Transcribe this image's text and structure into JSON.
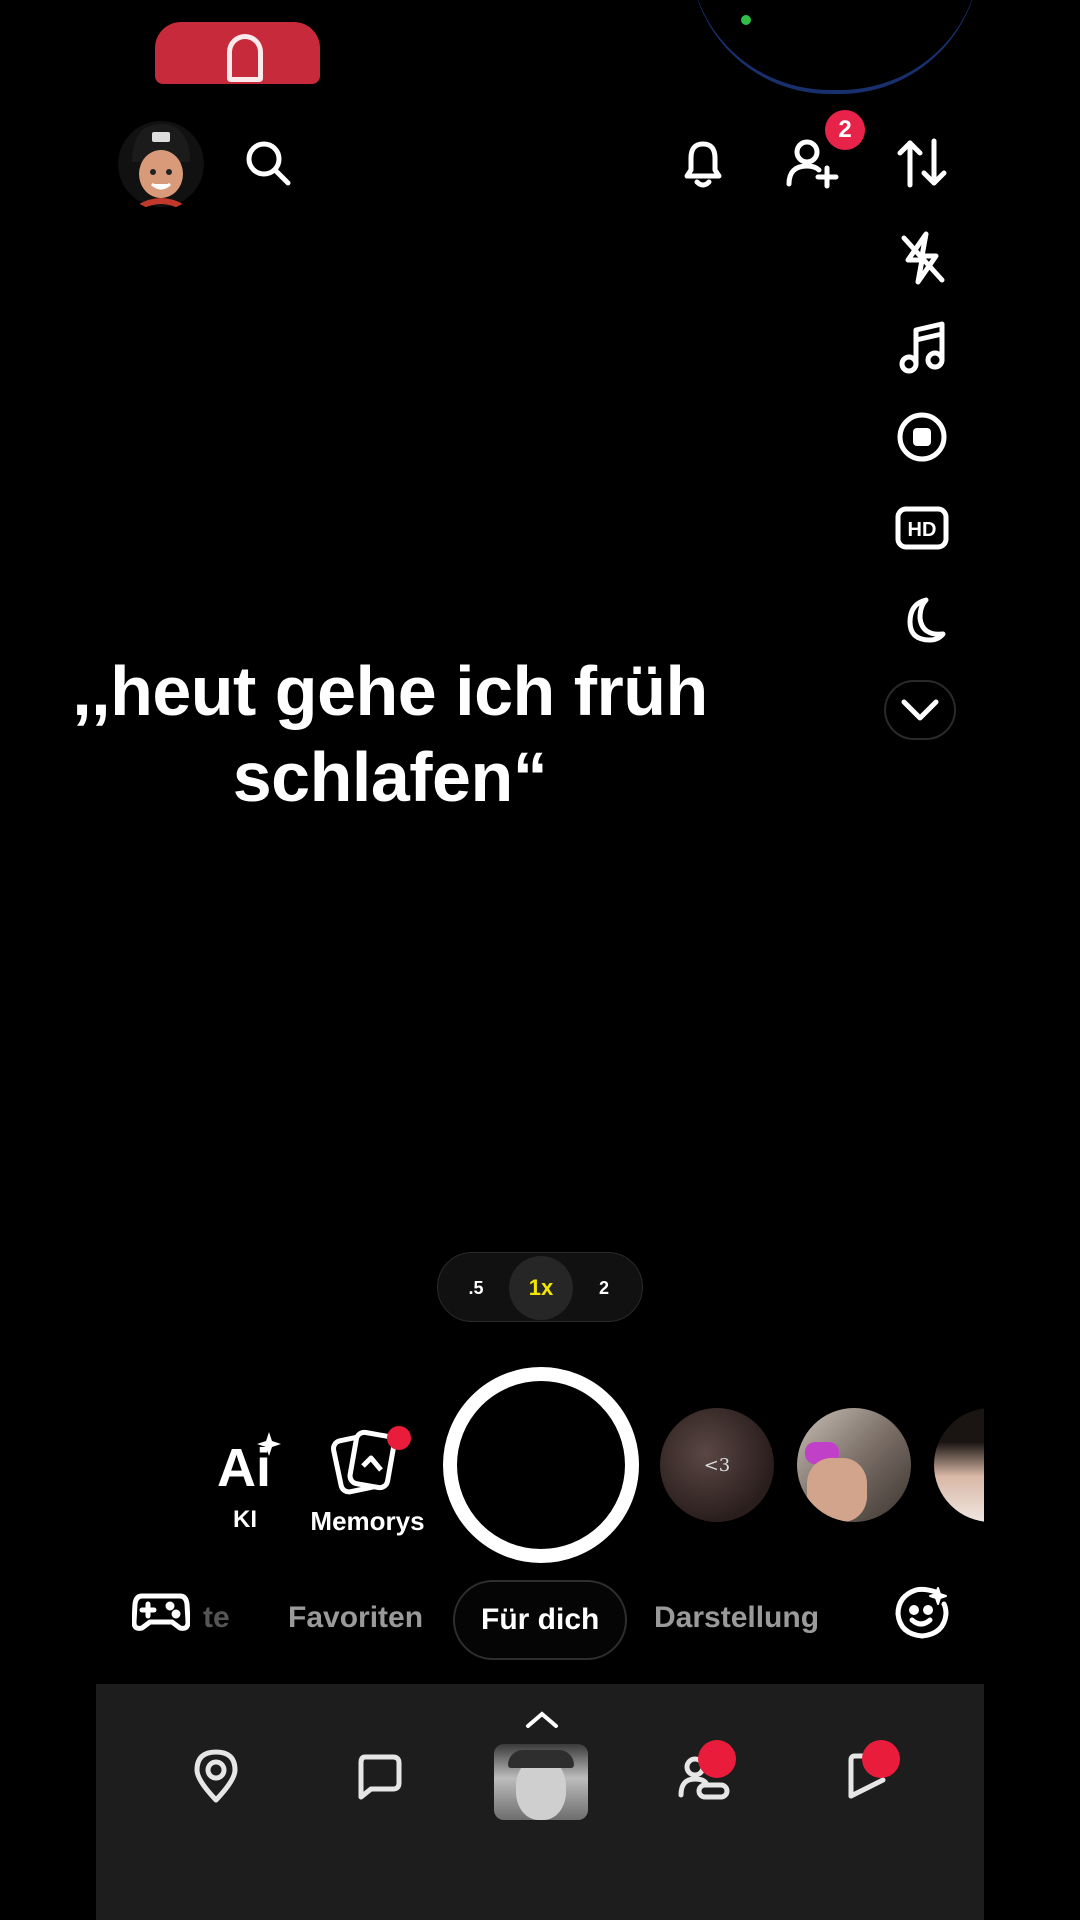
{
  "top_bar": {
    "avatar_icon": "bitmoji-avatar",
    "search_icon": "search-icon",
    "notifications_icon": "bell-icon",
    "add_friend_icon": "add-friend-icon",
    "add_friend_badge": "2",
    "flip_camera_icon": "flip-camera-icon"
  },
  "right_rail": [
    {
      "name": "flash-off-icon"
    },
    {
      "name": "music-icon"
    },
    {
      "name": "record-mode-icon"
    },
    {
      "name": "hd-icon"
    },
    {
      "name": "night-mode-icon"
    },
    {
      "name": "chevron-down-icon"
    }
  ],
  "caption": {
    "line1": ",,heut gehe ich früh",
    "line2": "schlafen“"
  },
  "zoom": {
    "options": [
      ".5",
      "1x",
      "2"
    ],
    "active": "1x"
  },
  "capture_row": {
    "ai_label": "KI",
    "memories_label": "Memorys",
    "story_1_text": "<3"
  },
  "tabs": {
    "partial_left": "te",
    "items": [
      "Favoriten",
      "Für dich",
      "Darstellung"
    ],
    "active": "Für dich"
  },
  "bottom_nav": {
    "items": [
      "map-pin-icon",
      "chat-icon",
      "camera-profile",
      "friends-icon",
      "stories-icon"
    ]
  },
  "colors": {
    "accent_yellow": "#f2e600",
    "badge_red": "#e8234a",
    "nav_bg": "#1d1d1d"
  }
}
